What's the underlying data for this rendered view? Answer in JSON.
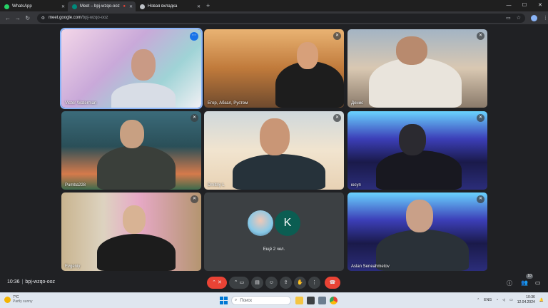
{
  "tabs": [
    {
      "label": "WhatsApp",
      "color": "#25d366"
    },
    {
      "label": "Meet – bpj-wzqo-ooz",
      "color": "#00897b"
    },
    {
      "label": "",
      "color": "#ea4335"
    },
    {
      "label": "Новая вкладка",
      "color": "#bdc1c6"
    }
  ],
  "address": {
    "host": "meet.google.com",
    "path": "/bpj-wzqo-ooz"
  },
  "tiles": [
    {
      "name": "Victor Waterman"
    },
    {
      "name": "Егор, Абзал, Рустем"
    },
    {
      "name": "Денис"
    },
    {
      "name": "Pumba228"
    },
    {
      "name": "Dmitriy L"
    },
    {
      "name": "юсуп"
    },
    {
      "name": "Evgeniy"
    },
    {
      "name": "Aslan Seneahmetov"
    }
  ],
  "others": {
    "avatar_letter": "K",
    "label": "Ещё 2 чел."
  },
  "meeting": {
    "time": "10:36",
    "code": "bpj-wzqo-ooz",
    "participants_badge": "10"
  },
  "taskbar": {
    "weather_temp": "7°C",
    "weather_desc": "Partly sunny",
    "search_placeholder": "Поиск",
    "lang": "ENG",
    "time": "10:36",
    "date": "12.04.2024"
  },
  "colors": {
    "end_call": "#ea4335",
    "speaking_outline": "#8ab4f8"
  }
}
